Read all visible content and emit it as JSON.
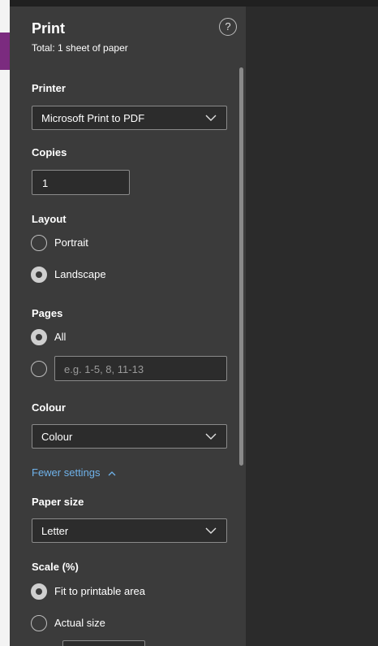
{
  "dialog": {
    "title": "Print",
    "subtitle": "Total: 1 sheet of paper",
    "help_label": "?"
  },
  "printer": {
    "label": "Printer",
    "selected": "Microsoft Print to PDF"
  },
  "copies": {
    "label": "Copies",
    "value": "1"
  },
  "layout": {
    "label": "Layout",
    "options": [
      {
        "label": "Portrait",
        "checked": false
      },
      {
        "label": "Landscape",
        "checked": true
      }
    ]
  },
  "pages": {
    "label": "Pages",
    "all_label": "All",
    "custom_placeholder": "e.g. 1-5, 8, 11-13"
  },
  "colour": {
    "label": "Colour",
    "selected": "Colour"
  },
  "fewer_settings": {
    "label": "Fewer settings"
  },
  "paper_size": {
    "label": "Paper size",
    "selected": "Letter"
  },
  "scale": {
    "label": "Scale (%)",
    "options": [
      {
        "label": "Fit to printable area",
        "checked": true
      },
      {
        "label": "Actual size",
        "checked": false
      }
    ]
  },
  "colors": {
    "panel_bg": "#3b3b3b",
    "preview_bg": "#2b2b2b",
    "link": "#6fb2ea"
  },
  "icons": [
    "help-icon",
    "chevron-down-icon",
    "chevron-up-icon"
  ]
}
